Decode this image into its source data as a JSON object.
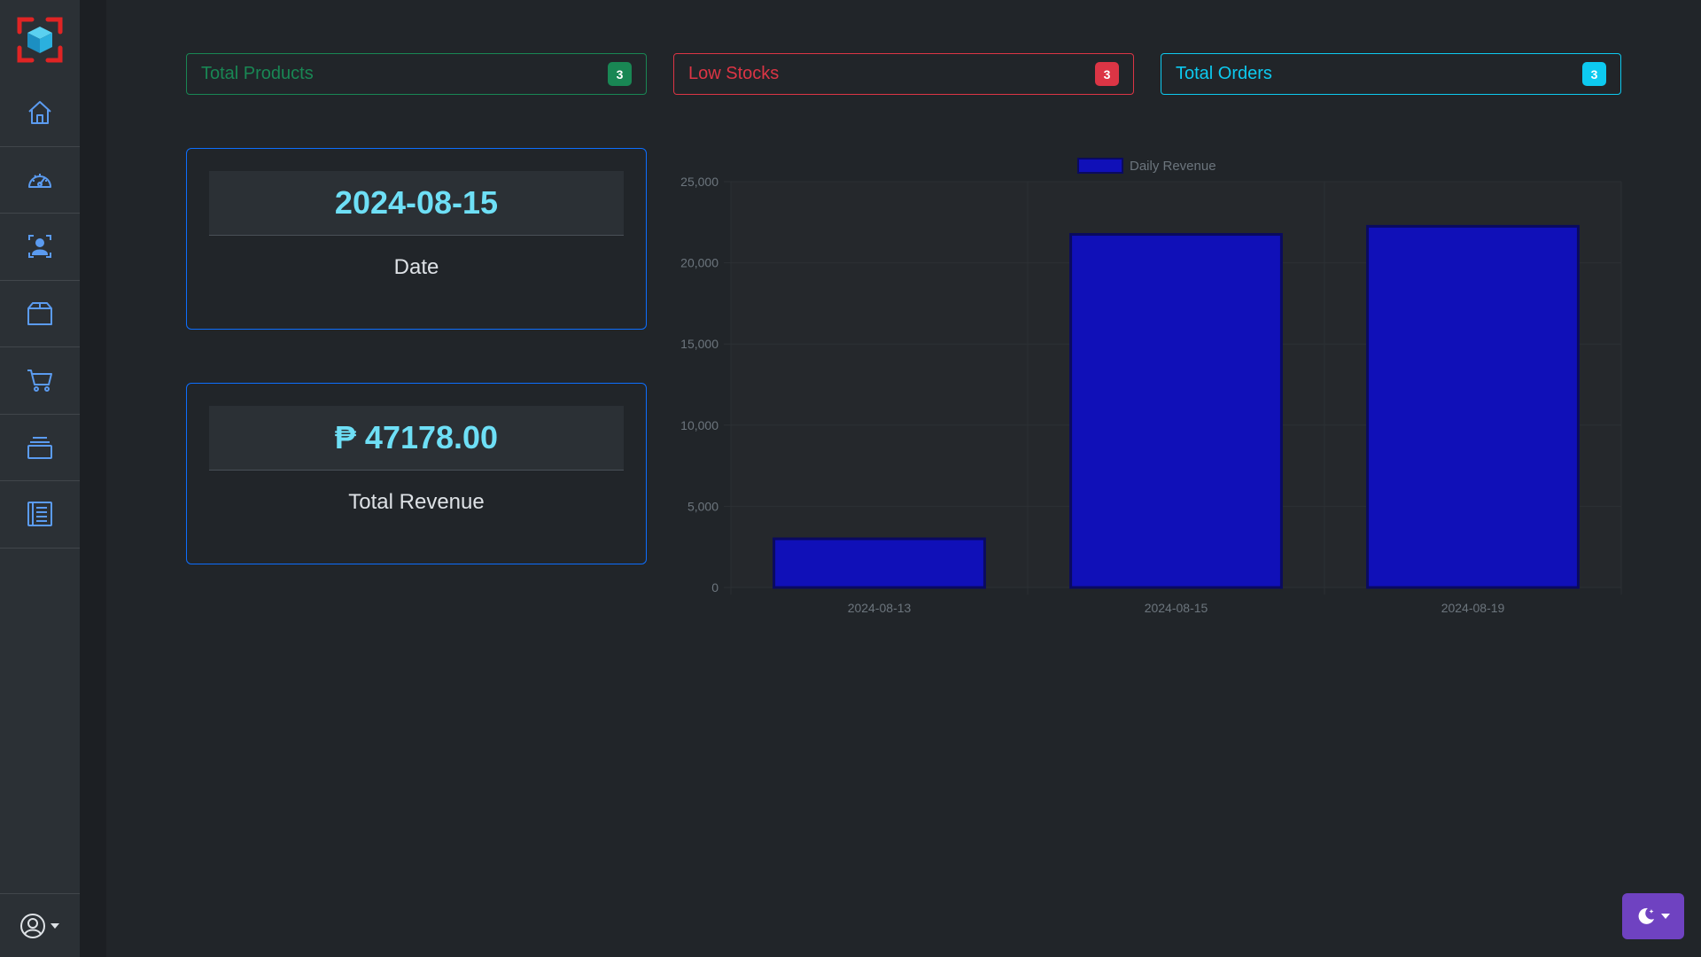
{
  "sidebar": {
    "logo": "app-logo",
    "items": [
      {
        "icon": "home-icon"
      },
      {
        "icon": "dashboard-gauge-icon"
      },
      {
        "icon": "users-icon"
      },
      {
        "icon": "box-icon"
      },
      {
        "icon": "cart-icon"
      },
      {
        "icon": "collection-icon"
      },
      {
        "icon": "report-icon"
      }
    ],
    "user_icon": "user-circle-icon"
  },
  "stats": [
    {
      "label": "Total Products",
      "count": "3",
      "color": "#198754"
    },
    {
      "label": "Low Stocks",
      "count": "3",
      "color": "#dc3545"
    },
    {
      "label": "Total Orders",
      "count": "3",
      "color": "#0dcaf0"
    }
  ],
  "date_card": {
    "value": "2024-08-15",
    "label": "Date"
  },
  "revenue_card": {
    "value": "₱ 47178.00",
    "label": "Total Revenue"
  },
  "chart_data": {
    "type": "bar",
    "categories": [
      "2024-08-13",
      "2024-08-15",
      "2024-08-19"
    ],
    "series": [
      {
        "name": "Daily Revenue",
        "values": [
          3000,
          21750,
          22250
        ],
        "color": "#1010b8"
      }
    ],
    "ylim": [
      0,
      25000
    ],
    "yticks": [
      "0",
      "5,000",
      "10,000",
      "15,000",
      "20,000",
      "25,000"
    ],
    "legend": "top-center",
    "grid": true
  },
  "theme_toggle": {
    "icon": "moon-stars-icon"
  },
  "colors": {
    "accent": "#6f42c1",
    "primary": "#0d6efd",
    "value": "#6edff6"
  }
}
